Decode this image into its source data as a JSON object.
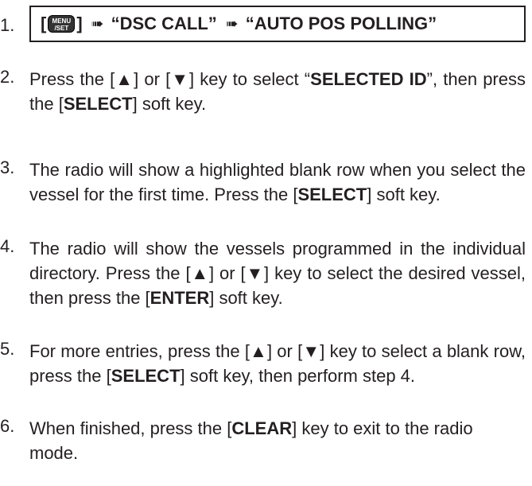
{
  "step1": {
    "number": "1.",
    "open_bracket": "[",
    "key_line1": "MENU",
    "key_line2": "/SET",
    "close_bracket": "]",
    "arrow_glyph": "➠",
    "item1": "“DSC CALL”",
    "item2": "“AUTO POS POLLING”"
  },
  "step2": {
    "number": "2.",
    "t1": "Press the [▲] or [▼] key to select “",
    "b1": "SELECTED ID",
    "t2": "”, then press the [",
    "b2": "SELECT",
    "t3": "] soft key."
  },
  "step3": {
    "number": "3.",
    "t1": "The radio will show a  highlighted blank row when you select the vessel for the first time. Press the [",
    "b1": "SELECT",
    "t2": "] soft key."
  },
  "step4": {
    "number": "4.",
    "t1": "The radio will show the vessels programmed in the individual directory. Press the [▲] or [▼] key to select the desired vessel, then press the [",
    "b1": "ENTER",
    "t2": "] soft key."
  },
  "step5": {
    "number": "5.",
    "t1": "For more entries, press the [▲] or [▼] key to select a blank row, press the [",
    "b1": "SELECT",
    "t2": "] soft key, then perform step 4."
  },
  "step6": {
    "number": "6.",
    "t1": "When finished, press the [",
    "b1": "CLEAR",
    "t2": "] key to exit to the radio mode."
  }
}
